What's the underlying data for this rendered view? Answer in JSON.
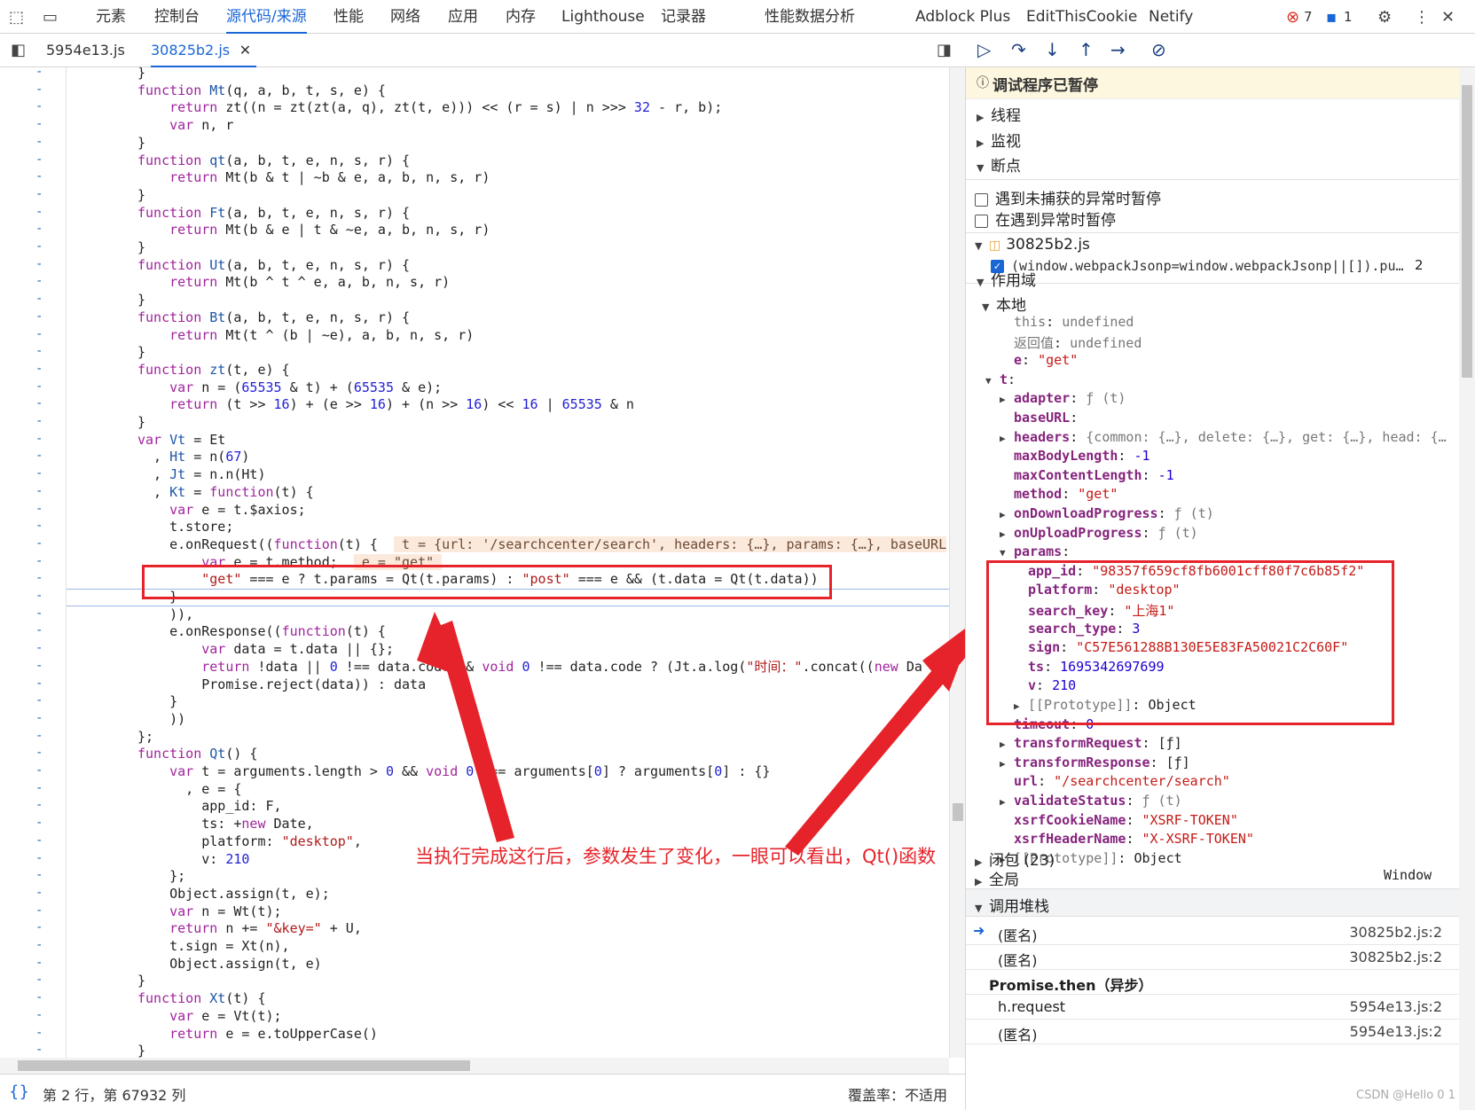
{
  "topbar": {
    "tabs": [
      "元素",
      "控制台",
      "源代码/来源",
      "性能",
      "网络",
      "应用",
      "内存",
      "Lighthouse",
      "记录器",
      "性能数据分析",
      "Adblock Plus",
      "EditThisCookie",
      "Netify"
    ],
    "error_count": "7",
    "message_count": "1"
  },
  "filetabs": [
    "5954e13.js",
    "30825b2.js"
  ],
  "code_lines": [
    {
      "gl": "-",
      "html": "}"
    },
    {
      "gl": "-",
      "html": "<span class='kw'>function</span> <span class='fn'>Mt</span>(q, a, b, t, s, e) {"
    },
    {
      "gl": "-",
      "html": "    <span class='kw'>return</span> zt((n = zt(zt(a, q), zt(t, e))) &lt;&lt; (r = s) | n &gt;&gt;&gt; <span class='nm'>32</span> - r, b);"
    },
    {
      "gl": "-",
      "html": "    <span class='kw'>var</span> n, r"
    },
    {
      "gl": "-",
      "html": "}"
    },
    {
      "gl": "-",
      "html": "<span class='kw'>function</span> <span class='fn'>qt</span>(a, b, t, e, n, s, r) {"
    },
    {
      "gl": "-",
      "html": "    <span class='kw'>return</span> Mt(b &amp; t | ~b &amp; e, a, b, n, s, r)"
    },
    {
      "gl": "-",
      "html": "}"
    },
    {
      "gl": "-",
      "html": "<span class='kw'>function</span> <span class='fn'>Ft</span>(a, b, t, e, n, s, r) {"
    },
    {
      "gl": "-",
      "html": "    <span class='kw'>return</span> Mt(b &amp; e | t &amp; ~e, a, b, n, s, r)"
    },
    {
      "gl": "-",
      "html": "}"
    },
    {
      "gl": "-",
      "html": "<span class='kw'>function</span> <span class='fn'>Ut</span>(a, b, t, e, n, s, r) {"
    },
    {
      "gl": "-",
      "html": "    <span class='kw'>return</span> Mt(b ^ t ^ e, a, b, n, s, r)"
    },
    {
      "gl": "-",
      "html": "}"
    },
    {
      "gl": "-",
      "html": "<span class='kw'>function</span> <span class='fn'>Bt</span>(a, b, t, e, n, s, r) {"
    },
    {
      "gl": "-",
      "html": "    <span class='kw'>return</span> Mt(t ^ (b | ~e), a, b, n, s, r)"
    },
    {
      "gl": "-",
      "html": "}"
    },
    {
      "gl": "-",
      "html": "<span class='kw'>function</span> <span class='fn'>zt</span>(t, e) {"
    },
    {
      "gl": "-",
      "html": "    <span class='kw'>var</span> n = (<span class='nm'>65535</span> &amp; t) + (<span class='nm'>65535</span> &amp; e);"
    },
    {
      "gl": "-",
      "html": "    <span class='kw'>return</span> (t &gt;&gt; <span class='nm'>16</span>) + (e &gt;&gt; <span class='nm'>16</span>) + (n &gt;&gt; <span class='nm'>16</span>) &lt;&lt; <span class='nm'>16</span> | <span class='nm'>65535</span> &amp; n"
    },
    {
      "gl": "-",
      "html": "}"
    },
    {
      "gl": "-",
      "html": "<span class='kw'>var</span> <span class='fn'>Vt</span> = Et"
    },
    {
      "gl": "-",
      "html": "  , <span class='fn'>Ht</span> = n(<span class='nm'>67</span>)"
    },
    {
      "gl": "-",
      "html": "  , <span class='fn'>Jt</span> = n.n(Ht)"
    },
    {
      "gl": "-",
      "html": "  , <span class='fn'>Kt</span> = <span class='kw'>function</span>(t) {"
    },
    {
      "gl": "-",
      "html": "    <span class='kw'>var</span> e = t.$axios;"
    },
    {
      "gl": "-",
      "html": "    t.store;"
    },
    {
      "gl": "-",
      "html": "    e.onRequest((<span class='kw'>function</span>(t) {  <span class='hlinline'> t = {url: '/searchcenter/search', headers: {…}, params: {…}, baseURL</span>"
    },
    {
      "gl": "-",
      "html": "        <span class='kw'>var</span> e = t.method;  <span class='hlinline'> e = \"get\" </span>"
    },
    {
      "gl": "-",
      "html": "        <span class='st'>\"get\"</span> === e ? t.params = Qt(t.params) : <span class='st'>\"post\"</span> === e &amp;&amp; (t.data = Qt(t.data))"
    },
    {
      "gl": "-",
      "html": "    }"
    },
    {
      "gl": "-",
      "html": "    )),"
    },
    {
      "gl": "-",
      "html": "    e.onResponse((<span class='kw'>function</span>(t) {"
    },
    {
      "gl": "-",
      "html": "        <span class='kw'>var</span> data = t.data || {};"
    },
    {
      "gl": "-",
      "html": "        <span class='kw'>return</span> !data || <span class='nm'>0</span> !== data.code &amp;&amp; <span class='kw'>void</span> <span class='nm'>0</span> !== data.code ? (Jt.a.log(<span class='st'>\"时间：\"</span>.concat((<span class='kw'>new</span> Da"
    },
    {
      "gl": "-",
      "html": "        Promise.reject(data)) : data"
    },
    {
      "gl": "-",
      "html": "    }"
    },
    {
      "gl": "-",
      "html": "    ))"
    },
    {
      "gl": "-",
      "html": "};"
    },
    {
      "gl": "-",
      "html": "<span class='kw'>function</span> <span class='fn'>Qt</span>() {"
    },
    {
      "gl": "-",
      "html": "    <span class='kw'>var</span> t = arguments.length &gt; <span class='nm'>0</span> &amp;&amp; <span class='kw'>void</span> <span class='nm'>0</span> !== arguments[<span class='nm'>0</span>] ? arguments[<span class='nm'>0</span>] : {}"
    },
    {
      "gl": "-",
      "html": "      , e = {"
    },
    {
      "gl": "-",
      "html": "        app_id: F,"
    },
    {
      "gl": "-",
      "html": "        ts: +<span class='kw'>new</span> Date,"
    },
    {
      "gl": "-",
      "html": "        platform: <span class='st'>\"desktop\"</span>,"
    },
    {
      "gl": "-",
      "html": "        v: <span class='nm'>210</span>"
    },
    {
      "gl": "-",
      "html": "    };"
    },
    {
      "gl": "-",
      "html": "    Object.assign(t, e);"
    },
    {
      "gl": "-",
      "html": "    <span class='kw'>var</span> n = Wt(t);"
    },
    {
      "gl": "-",
      "html": "    <span class='kw'>return</span> n += <span class='st'>\"&amp;key=\"</span> + U,"
    },
    {
      "gl": "-",
      "html": "    t.sign = Xt(n),"
    },
    {
      "gl": "-",
      "html": "    Object.assign(t, e)"
    },
    {
      "gl": "-",
      "html": "}"
    },
    {
      "gl": "-",
      "html": "<span class='kw'>function</span> <span class='fn'>Xt</span>(t) {"
    },
    {
      "gl": "-",
      "html": "    <span class='kw'>var</span> e = Vt(t);"
    },
    {
      "gl": "-",
      "html": "    <span class='kw'>return</span> e = e.toUpperCase()"
    },
    {
      "gl": "-",
      "html": "}"
    }
  ],
  "annotation": "当执行完成这行后，参数发生了变化，一眼可以看出，Qt()函数",
  "status": {
    "position": "第 2 行，第 67932 列",
    "coverage": "覆盖率：不适用"
  },
  "right": {
    "paused": "调试程序已暂停",
    "threads": "线程",
    "watch": "监视",
    "breakpoints": "断点",
    "uncaught": "遇到未捕获的异常时暂停",
    "caught": "在遇到异常时暂停",
    "bp_file": "30825b2.js",
    "bp_code": "(window.webpackJsonp=window.webpackJsonp||[]).pu…",
    "bp_line": "2",
    "scope": "作用域",
    "local": "本地",
    "scope_lines": [
      {
        "i": 0,
        "k": "this",
        "v": "undefined",
        "c": "pg",
        "kc": "pg"
      },
      {
        "i": 0,
        "k": "返回值",
        "v": "undefined",
        "c": "pg",
        "kc": "pg"
      },
      {
        "i": 0,
        "k": "e",
        "v": "\"get\"",
        "c": "pv",
        "kc": "pk"
      },
      {
        "i": -1,
        "k": "t",
        "v": "",
        "c": "pv",
        "kc": "pk",
        "t": "▼"
      },
      {
        "i": 1,
        "k": "adapter",
        "v": "ƒ (t)",
        "c": "pg",
        "kc": "pk",
        "t": "▶"
      },
      {
        "i": 1,
        "k": "baseURL",
        "v": "",
        "c": "pv",
        "kc": "pk"
      },
      {
        "i": 1,
        "k": "headers",
        "v": "{common: {…}, delete: {…}, get: {…}, head: {…",
        "c": "pg",
        "kc": "pk",
        "t": "▶"
      },
      {
        "i": 1,
        "k": "maxBodyLength",
        "v": "-1",
        "c": "pn",
        "kc": "pk"
      },
      {
        "i": 1,
        "k": "maxContentLength",
        "v": "-1",
        "c": "pn",
        "kc": "pk"
      },
      {
        "i": 1,
        "k": "method",
        "v": "\"get\"",
        "c": "pv",
        "kc": "pk"
      },
      {
        "i": 1,
        "k": "onDownloadProgress",
        "v": "ƒ (t)",
        "c": "pg",
        "kc": "pk",
        "t": "▶"
      },
      {
        "i": 1,
        "k": "onUploadProgress",
        "v": "ƒ (t)",
        "c": "pg",
        "kc": "pk",
        "t": "▶"
      },
      {
        "i": 1,
        "k": "params",
        "v": "",
        "c": "pv",
        "kc": "pk",
        "t": "▼"
      },
      {
        "i": 2,
        "k": "app_id",
        "v": "\"98357f659cf8fb6001cff80f7c6b85f2\"",
        "c": "pv",
        "kc": "pk"
      },
      {
        "i": 2,
        "k": "platform",
        "v": "\"desktop\"",
        "c": "pv",
        "kc": "pk"
      },
      {
        "i": 2,
        "k": "search_key",
        "v": "\"上海1\"",
        "c": "pv",
        "kc": "pk"
      },
      {
        "i": 2,
        "k": "search_type",
        "v": "3",
        "c": "pn",
        "kc": "pk"
      },
      {
        "i": 2,
        "k": "sign",
        "v": "\"C57E561288B130E5E83FA50021C2C60F\"",
        "c": "pv",
        "kc": "pk"
      },
      {
        "i": 2,
        "k": "ts",
        "v": "1695342697699",
        "c": "pn",
        "kc": "pk"
      },
      {
        "i": 2,
        "k": "v",
        "v": "210",
        "c": "pn",
        "kc": "pk"
      },
      {
        "i": 2,
        "k": "[[Prototype]]",
        "v": "Object",
        "c": "pr",
        "kc": "pg",
        "t": "▶"
      },
      {
        "i": 1,
        "k": "timeout",
        "v": "0",
        "c": "pn",
        "kc": "pk"
      },
      {
        "i": 1,
        "k": "transformRequest",
        "v": "[ƒ]",
        "c": "pr",
        "kc": "pk",
        "t": "▶"
      },
      {
        "i": 1,
        "k": "transformResponse",
        "v": "[ƒ]",
        "c": "pr",
        "kc": "pk",
        "t": "▶"
      },
      {
        "i": 1,
        "k": "url",
        "v": "\"/searchcenter/search\"",
        "c": "pv",
        "kc": "pk"
      },
      {
        "i": 1,
        "k": "validateStatus",
        "v": "ƒ (t)",
        "c": "pg",
        "kc": "pk",
        "t": "▶"
      },
      {
        "i": 1,
        "k": "xsrfCookieName",
        "v": "\"XSRF-TOKEN\"",
        "c": "pv",
        "kc": "pk"
      },
      {
        "i": 1,
        "k": "xsrfHeaderName",
        "v": "\"X-XSRF-TOKEN\"",
        "c": "pv",
        "kc": "pk"
      },
      {
        "i": 1,
        "k": "[[Prototype]]",
        "v": "Object",
        "c": "pr",
        "kc": "pg",
        "t": "▶"
      }
    ],
    "closure": "闭包 (23)",
    "global": "全局",
    "global_val": "Window",
    "callstack": "调用堆栈",
    "frames": [
      {
        "name": "(匿名)",
        "loc": "30825b2.js:2",
        "cur": true
      },
      {
        "name": "(匿名)",
        "loc": "30825b2.js:2",
        "cur": false
      },
      {
        "name": "Promise.then（异步）",
        "loc": "",
        "cur": false,
        "async": true
      },
      {
        "name": "h.request",
        "loc": "5954e13.js:2",
        "cur": false
      },
      {
        "name": "(匿名)",
        "loc": "5954e13.js:2",
        "cur": false
      }
    ],
    "watermark": "CSDN @Hello 0 1"
  },
  "colors": {
    "accent": "#1a66d6",
    "annot": "#e6232a",
    "paused_bg": "#fdf7df"
  }
}
